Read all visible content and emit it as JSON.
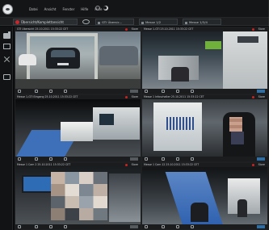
{
  "menu": {
    "items": [
      "Datei",
      "Ansicht",
      "Fenster",
      "Hilfe",
      "Hilfe"
    ]
  },
  "toolbar": {
    "layout_label": "Übersicht/Komplettansicht",
    "tabs": [
      "GTI Übersic...",
      "Messe 1/2",
      "Messe 1/3/4"
    ]
  },
  "tiles": [
    {
      "title": "GTI Übersicht 25.10.2011 15:33:22 CET",
      "badge": "Store"
    },
    {
      "title": "Messe 1-GTI 25.10.2011 15:33:22 CET",
      "badge": "Store"
    },
    {
      "title": "Messe 1-GTI Eingang 25.10.2011 15:33:22 CET",
      "badge": "Store"
    },
    {
      "title": "Messe 1 Infoschalter 25.10.2011 15:33:22 CET",
      "badge": "Store"
    },
    {
      "title": "Messe 1 Cam 2 25.10.2011 15:33:22 CET",
      "badge": "Store"
    },
    {
      "title": "Messe 1 Cam 12 25.10.2011 15:33:22 CET",
      "badge": "Store"
    }
  ],
  "colors": {
    "record": "#c8282b",
    "accent": "#2c6fa8",
    "background": "#0b0c0d"
  }
}
